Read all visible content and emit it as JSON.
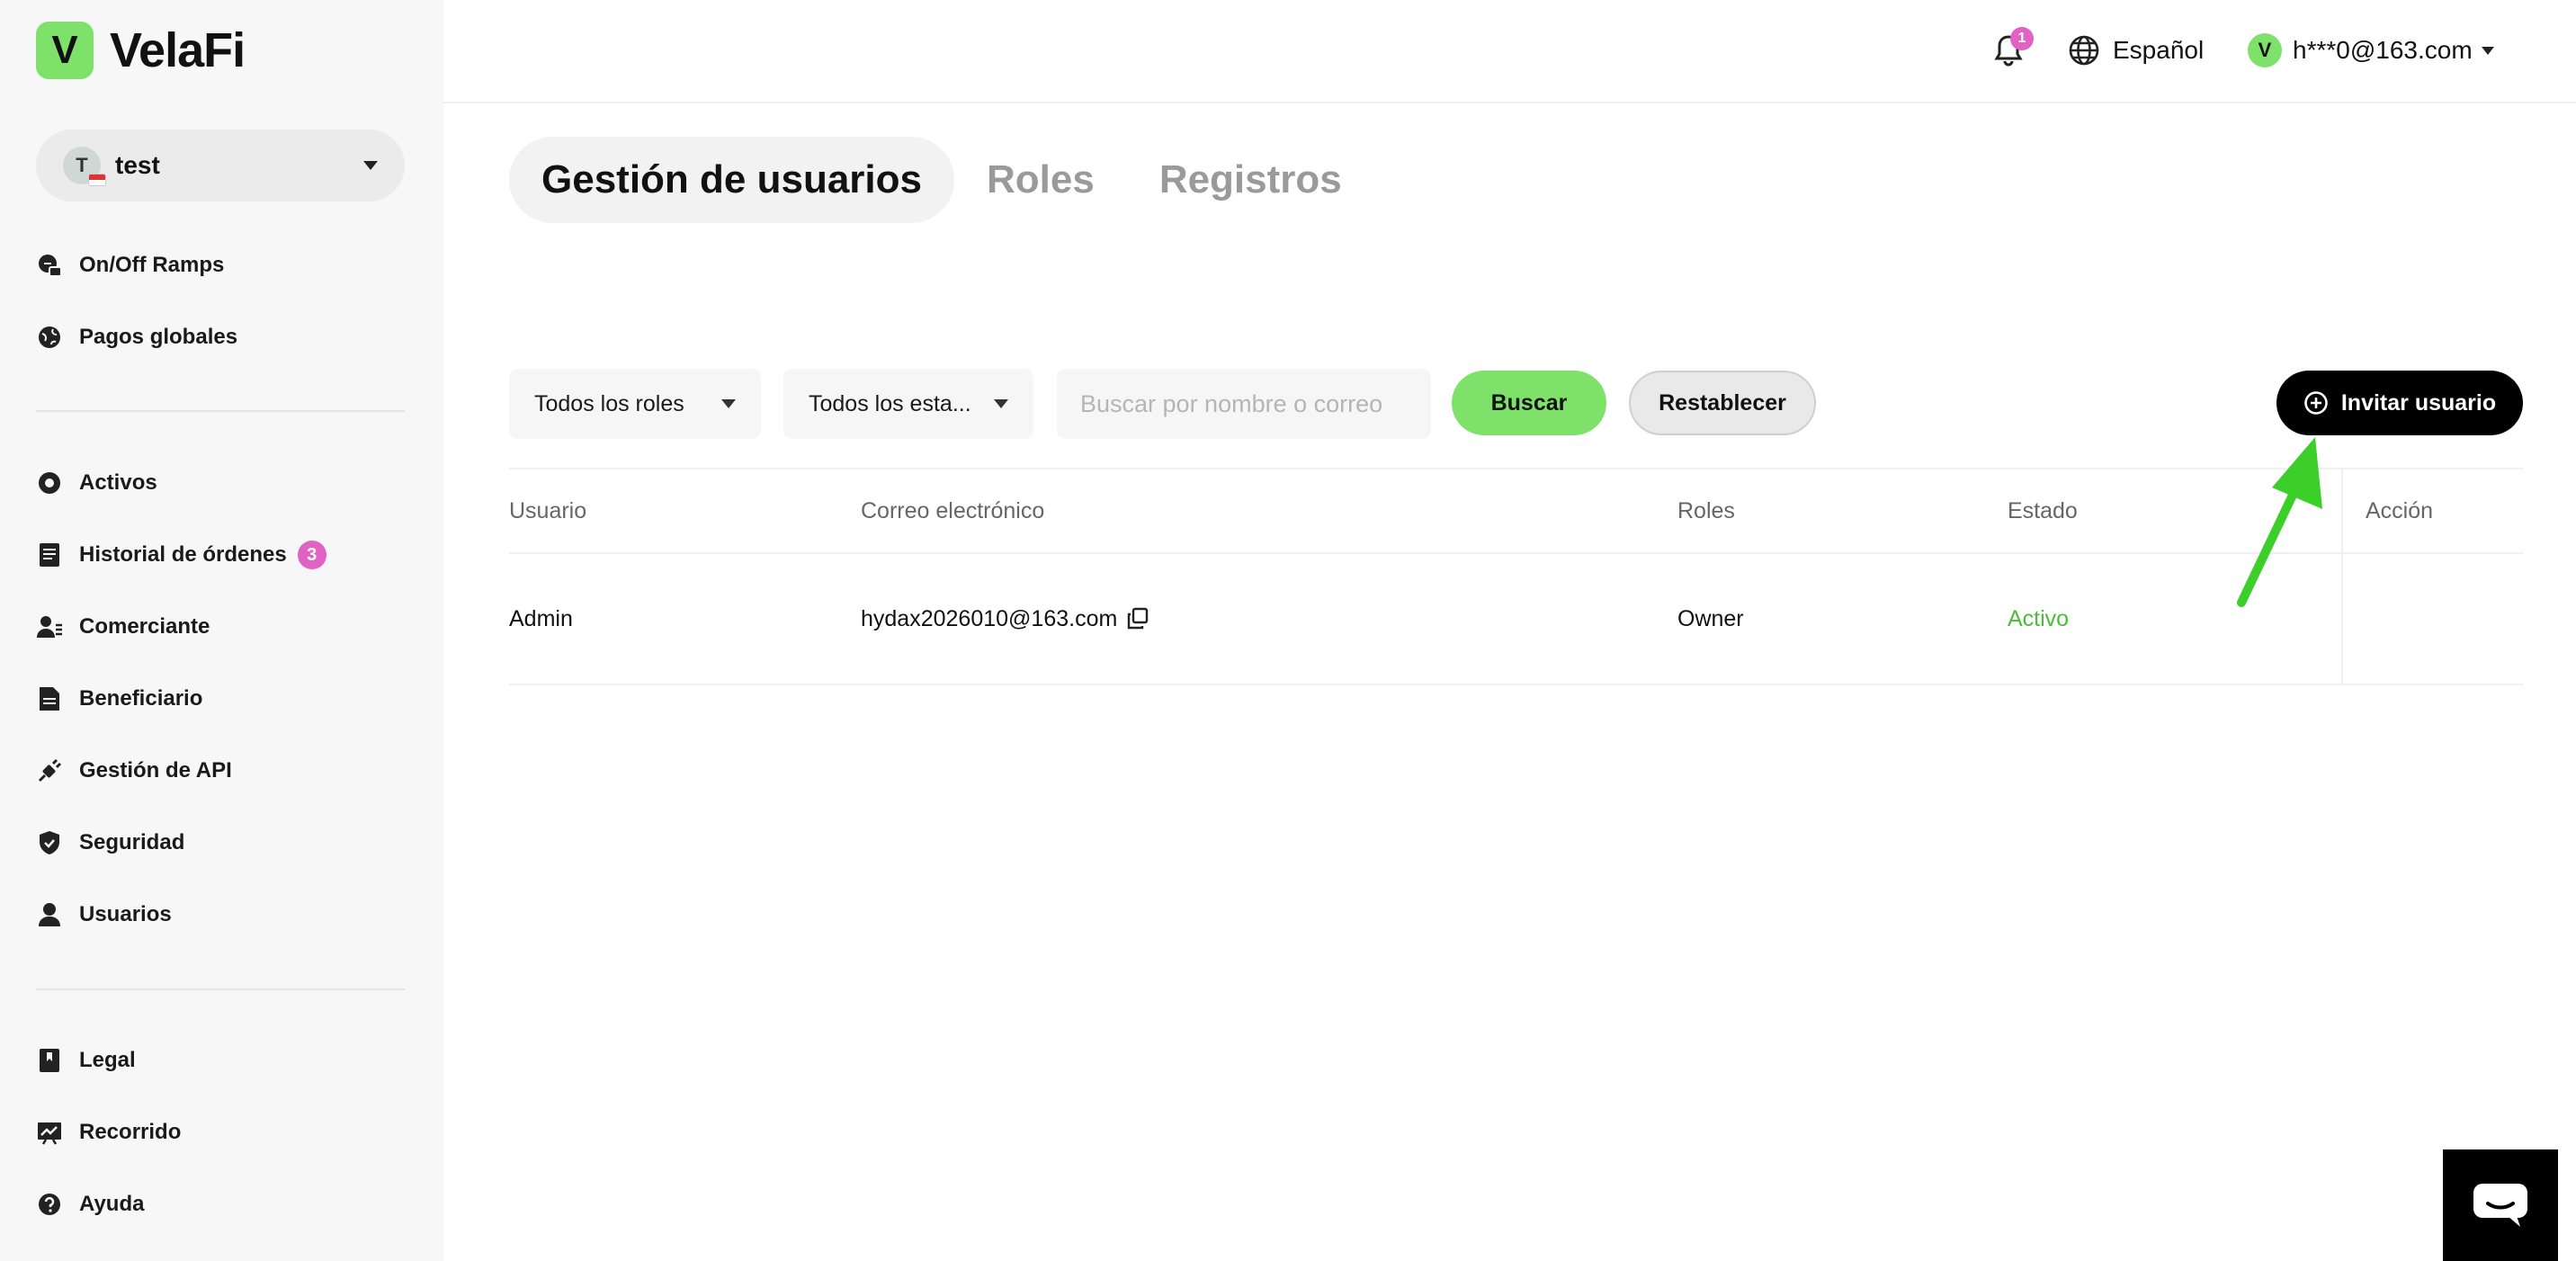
{
  "brand": {
    "logo_letter": "V",
    "name": "VelaFi",
    "accent": "#7ee26a"
  },
  "org": {
    "initial": "T",
    "name": "test"
  },
  "sidebar": {
    "group1": [
      {
        "label": "On/Off Ramps",
        "icon": "ramp-icon"
      },
      {
        "label": "Pagos globales",
        "icon": "globe-icon"
      }
    ],
    "group2": [
      {
        "label": "Activos",
        "icon": "asset-icon"
      },
      {
        "label": "Historial de órdenes",
        "icon": "document-icon",
        "badge": "3"
      },
      {
        "label": "Comerciante",
        "icon": "merchant-icon"
      },
      {
        "label": "Beneficiario",
        "icon": "beneficiary-icon"
      },
      {
        "label": "Gestión de API",
        "icon": "api-icon"
      },
      {
        "label": "Seguridad",
        "icon": "shield-icon"
      },
      {
        "label": "Usuarios",
        "icon": "user-icon"
      }
    ],
    "group3": [
      {
        "label": "Legal",
        "icon": "legal-icon"
      },
      {
        "label": "Recorrido",
        "icon": "tour-icon"
      },
      {
        "label": "Ayuda",
        "icon": "help-icon"
      }
    ]
  },
  "header": {
    "notification_count": "1",
    "language": "Español",
    "account_initial": "V",
    "account_email": "h***0@163.com"
  },
  "tabs": [
    {
      "label": "Gestión de usuarios",
      "active": true
    },
    {
      "label": "Roles",
      "active": false
    },
    {
      "label": "Registros",
      "active": false
    }
  ],
  "filters": {
    "roles": "Todos los roles",
    "status": "Todos los esta...",
    "search_placeholder": "Buscar por nombre o correo",
    "search_button": "Buscar",
    "reset_button": "Restablecer",
    "invite_button": "Invitar usuario"
  },
  "table": {
    "columns": [
      "Usuario",
      "Correo electrónico",
      "Roles",
      "Estado",
      "Acción"
    ],
    "rows": [
      {
        "user": "Admin",
        "email": "hydax2026010@163.com",
        "role": "Owner",
        "status": "Activo"
      }
    ]
  },
  "colors": {
    "active_status": "#4cbb3c",
    "badge": "#e062c4",
    "annotation_arrow": "#3ccf2a"
  }
}
